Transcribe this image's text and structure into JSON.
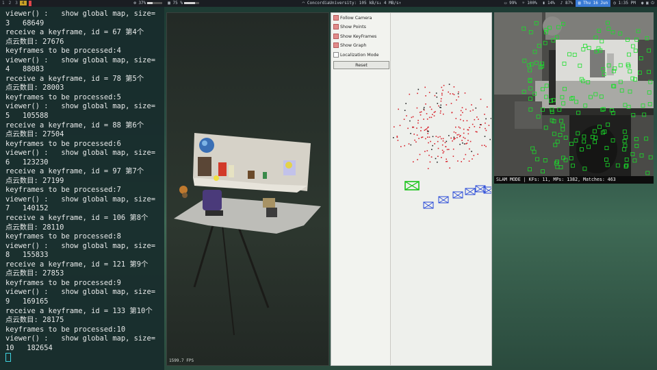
{
  "topbar": {
    "workspaces": [
      "1",
      "2",
      "3",
      "4"
    ],
    "active_workspace": "4",
    "items": [
      {
        "icon": "cpu-icon",
        "text": "37%",
        "level": 0.37
      },
      {
        "icon": "memory-icon",
        "text": "75 %",
        "level": 0.75
      },
      {
        "icon": "network-icon",
        "text": "ConcordiaUniversity: 105 kB/s↓  4 MB/s↑"
      },
      {
        "icon": "disk-icon",
        "text": "99%"
      },
      {
        "icon": "brightness-icon",
        "text": "100%"
      },
      {
        "icon": "battery-icon",
        "text": "14%"
      },
      {
        "icon": "volume-icon",
        "text": "87%"
      }
    ],
    "date": "Thu 16 Jun",
    "time": "1:35 PM"
  },
  "terminal": {
    "lines": [
      "viewer() :   show global map, size=",
      "3   68649",
      "receive a keyframe, id = 67 第4个",
      "点云数目: 27676",
      "keyframes to be processed:4",
      "viewer() :   show global map, size=",
      "4   88083",
      "receive a keyframe, id = 78 第5个",
      "点云数目: 28003",
      "keyframes to be processed:5",
      "viewer() :   show global map, size=",
      "5   105588",
      "receive a keyframe, id = 88 第6个",
      "点云数目: 27504",
      "keyframes to be processed:6",
      "viewer() :   show global map, size=",
      "6   123230",
      "receive a keyframe, id = 97 第7个",
      "点云数目: 27199",
      "keyframes to be processed:7",
      "viewer() :   show global map, size=",
      "7   140152",
      "receive a keyframe, id = 106 第8个",
      "点云数目: 28110",
      "keyframes to be processed:8",
      "viewer() :   show global map, size=",
      "8   155833",
      "receive a keyframe, id = 121 第9个",
      "点云数目: 27853",
      "keyframes to be processed:9",
      "viewer() :   show global map, size=",
      "9   169165",
      "receive a keyframe, id = 133 第10个",
      "点云数目: 28175",
      "keyframes to be processed:10",
      "viewer() :   show global map, size=",
      "10   182654"
    ]
  },
  "cloud_viewer": {
    "fps": "1599.7 FPS"
  },
  "map_viewer": {
    "options": [
      {
        "label": "Follow Camera",
        "checked": true
      },
      {
        "label": "Show Points",
        "checked": true
      },
      {
        "label": "Show KeyFrames",
        "checked": true
      },
      {
        "label": "Show Graph",
        "checked": true
      },
      {
        "label": "Localization Mode",
        "checked": false
      }
    ],
    "reset_label": "Reset"
  },
  "camera_view": {
    "status": "SLAM MODE |  KFs: 11, MPs: 1382, Matches: 463"
  },
  "colors": {
    "accent_workspace": "#c9a227",
    "date_bg": "#3a7bd5",
    "feature_green": "#19e02a",
    "keyframe_blue": "#2748d8",
    "map_point_red": "#d8202a",
    "current_camera_green": "#18c418"
  }
}
